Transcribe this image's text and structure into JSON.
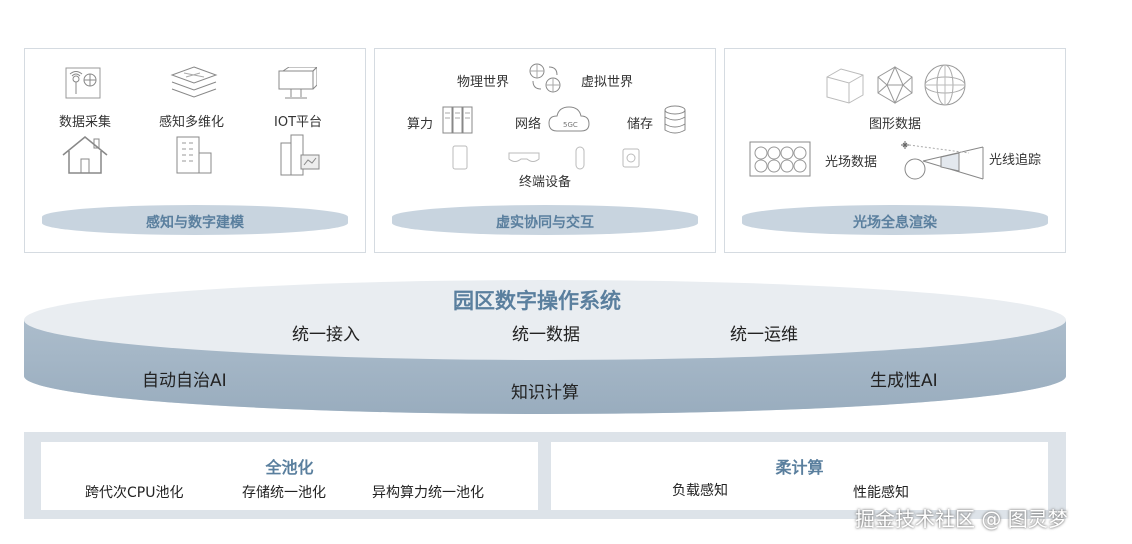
{
  "panels": {
    "perception": {
      "items": [
        "数据采集",
        "感知多维化",
        "IOT平台"
      ],
      "bar_label": "感知与数字建模"
    },
    "virtual": {
      "physical": "物理世界",
      "virtual": "虚拟世界",
      "compute": "算力",
      "network": "网络",
      "storage": "储存",
      "terminal": "终端设备",
      "cloud_tag": "5GC",
      "bar_label": "虚实协同与交互"
    },
    "lightfield": {
      "graphics": "图形数据",
      "lightfield": "光场数据",
      "raytrace": "光线追踪",
      "bar_label": "光场全息渲染"
    }
  },
  "os": {
    "title": "园区数字操作系统",
    "access": "统一接入",
    "data": "统一数据",
    "ops": "统一运维",
    "autonomous": "自动自治AI",
    "knowledge": "知识计算",
    "generative": "生成性AI"
  },
  "bottom": {
    "pooling": {
      "title": "全池化",
      "items": [
        "跨代次CPU池化",
        "存储统一池化",
        "异构算力统一池化"
      ]
    },
    "soft": {
      "title": "柔计算",
      "items": [
        "负载感知",
        "性能感知"
      ]
    }
  },
  "watermark": "掘金技术社区 @ 图灵梦",
  "colors": {
    "accent": "#5a7f9e",
    "bar": "#c8d4df",
    "disk_top": "#e9edf1",
    "disk_side": "#9fb2c3"
  }
}
